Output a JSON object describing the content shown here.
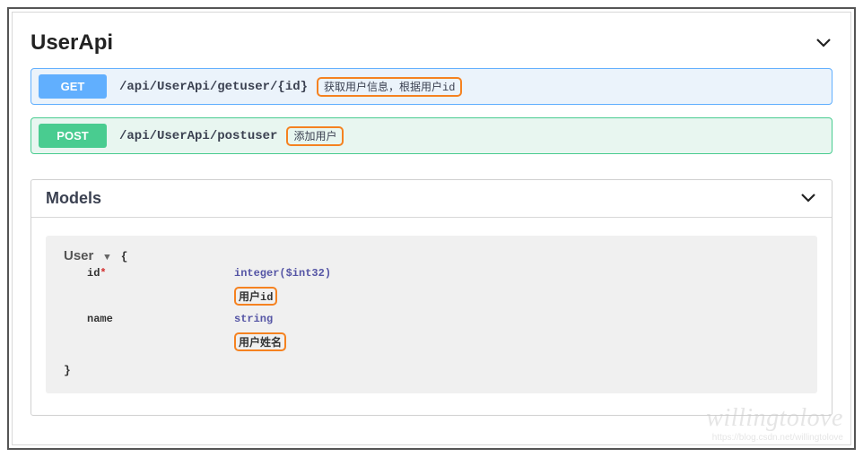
{
  "api_section": {
    "title": "UserApi",
    "endpoints": [
      {
        "method": "GET",
        "path": "/api/UserApi/getuser/{id}",
        "description": "获取用户信息，根据用户id"
      },
      {
        "method": "POST",
        "path": "/api/UserApi/postuser",
        "description": "添加用户"
      }
    ]
  },
  "models_section": {
    "title": "Models",
    "model": {
      "name": "User",
      "brace_open": "{",
      "brace_close": "}",
      "properties": [
        {
          "name": "id",
          "required_mark": "*",
          "type": "integer($int32)",
          "description": "用户id"
        },
        {
          "name": "name",
          "required_mark": "",
          "type": "string",
          "description": "用户姓名"
        }
      ]
    }
  },
  "watermark": {
    "main": "willingtolove",
    "sub": "https://blog.csdn.net/willingtolove"
  }
}
